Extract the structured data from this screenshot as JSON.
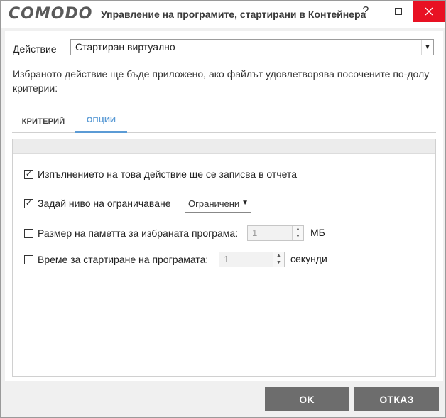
{
  "window": {
    "logo": "COMODO",
    "title": "Управление на програмите, стартирани в Контейнера",
    "help_label": "?"
  },
  "action": {
    "label": "Действие",
    "selected": "Стартиран виртуално"
  },
  "description": "Избраното действие ще бъде приложено, ако файлът удовлетворява посочените по-долу критерии:",
  "tabs": [
    {
      "label": "КРИТЕРИЙ",
      "active": false
    },
    {
      "label": "ОПЦИИ",
      "active": true
    }
  ],
  "options": {
    "log": {
      "label": "Изпълнението на това действие ще се записва в отчета",
      "checked": true
    },
    "restriction": {
      "label": "Задай ниво на ограничаване",
      "checked": true,
      "value": "Ограничени"
    },
    "memory": {
      "label": "Размер на паметта за избраната програма:",
      "checked": false,
      "value": "1",
      "unit": "МБ"
    },
    "time": {
      "label": "Време за стартиране на програмата:",
      "checked": false,
      "value": "1",
      "unit": "секунди"
    }
  },
  "buttons": {
    "ok": "OK",
    "cancel": "ОТКАЗ"
  },
  "colors": {
    "accent": "#5b9bd5",
    "close": "#e81123",
    "button": "#6d6d6d"
  }
}
